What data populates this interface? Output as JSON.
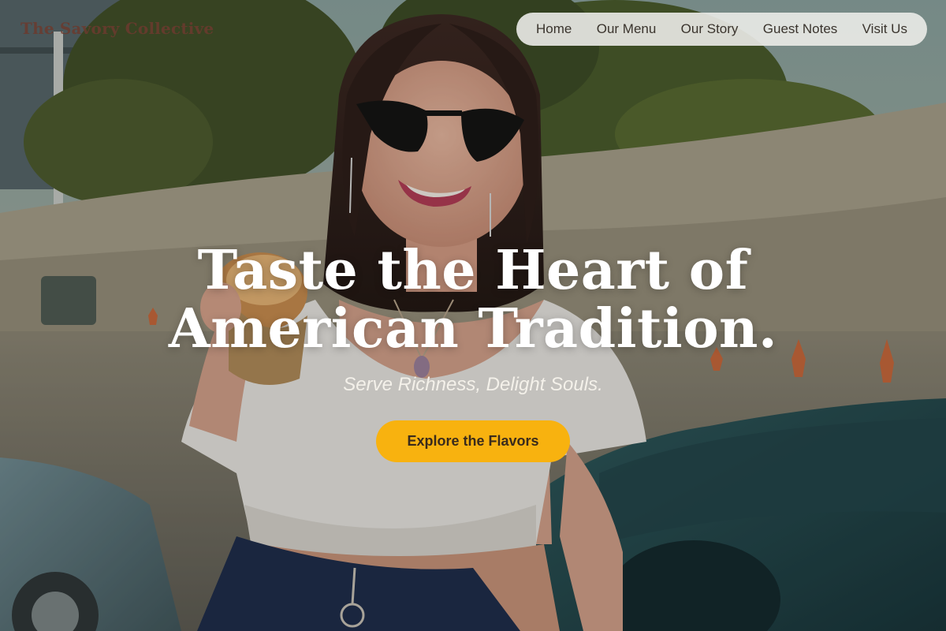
{
  "brand": {
    "name": "The Savory Collective"
  },
  "nav": {
    "items": [
      {
        "label": "Home"
      },
      {
        "label": "Our Menu"
      },
      {
        "label": "Our Story"
      },
      {
        "label": "Guest Notes"
      },
      {
        "label": "Visit Us"
      }
    ]
  },
  "hero": {
    "headline_line1": "Taste the Heart of",
    "headline_line2": "American Tradition.",
    "tagline": "Serve Richness, Delight Souls.",
    "cta_label": "Explore the Flavors",
    "background": "woman-holding-sandwich-photo"
  },
  "colors": {
    "accent": "#f8b20f",
    "brand_text": "#6b3a2e",
    "nav_bg": "#ebebe8",
    "headline": "#ffffff"
  }
}
